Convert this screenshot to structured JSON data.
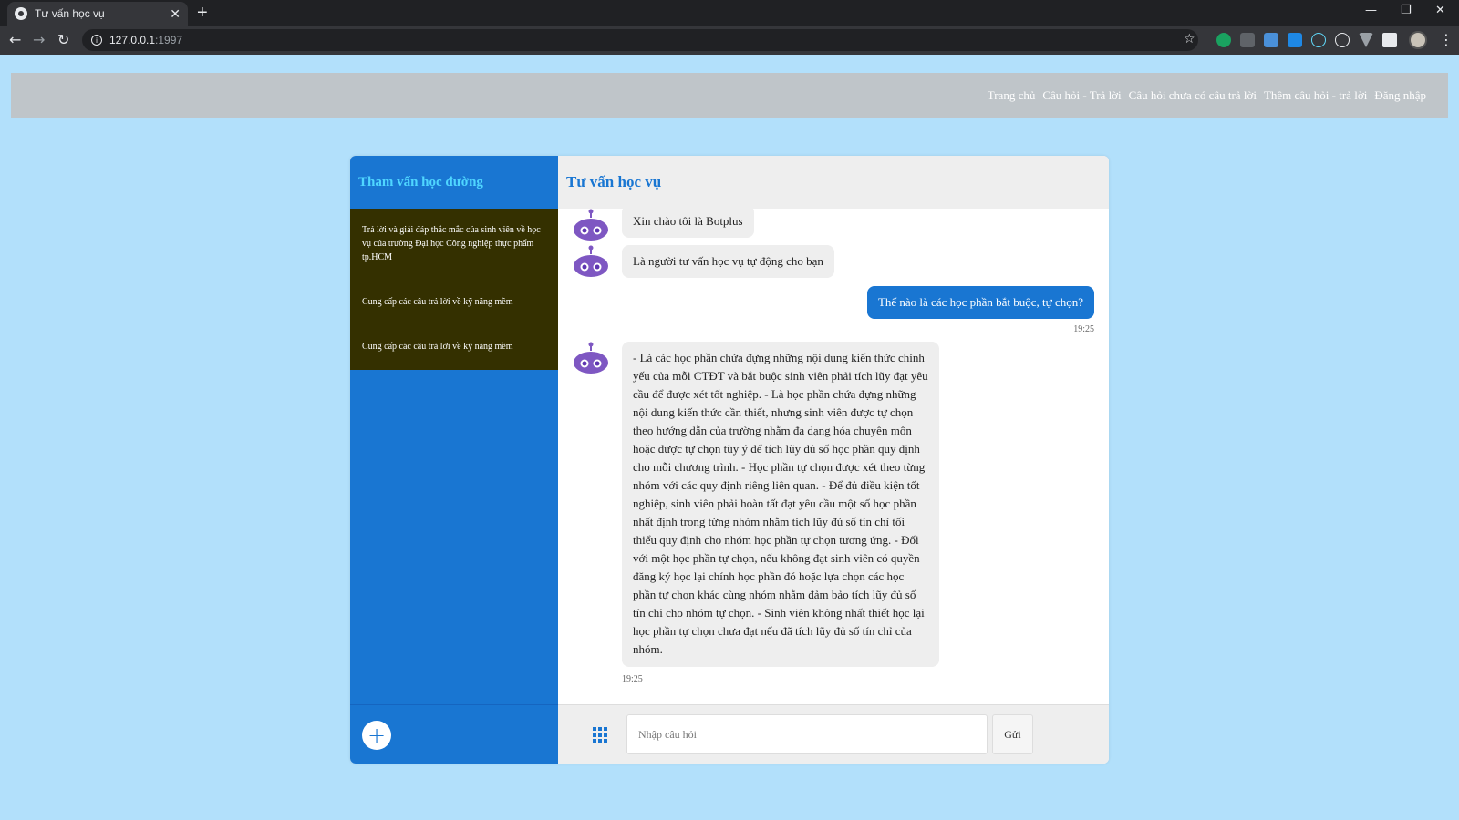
{
  "browser": {
    "tab_title": "Tư vấn học vụ",
    "tab_close": "✕",
    "new_tab": "+",
    "url_host": "127.0.0.1",
    "url_port": ":1997",
    "window_minimize": "—",
    "window_restore": "❐",
    "window_close": "✕",
    "nav_back": "←",
    "nav_forward": "→",
    "nav_reload": "↻",
    "bookmark": "☆",
    "menu": "⋮"
  },
  "topnav": {
    "items": [
      "Trang chủ",
      "Câu hỏi - Trả lời",
      "Câu hỏi chưa có câu trả lời",
      "Thêm câu hỏi - trả lời",
      "Đăng nhập"
    ]
  },
  "sidebar": {
    "title": "Tham vấn học đường",
    "items": [
      "Trả lời và giải đáp thắc mắc của sinh viên về học vụ của trường Đại học Công nghiệp thực phẩm tp.HCM",
      "Cung cấp các câu trả lời về kỹ năng mềm",
      "Cung cấp các câu trả lời về kỹ năng mềm"
    ],
    "add_label": "+"
  },
  "chat": {
    "title": "Tư vấn học vụ",
    "messages": [
      {
        "from": "bot",
        "text": "Xin chào tôi là Botplus"
      },
      {
        "from": "bot",
        "text": "Là người tư vấn học vụ tự động cho bạn"
      },
      {
        "from": "user",
        "text": "Thế nào là các học phần bắt buộc, tự chọn?",
        "time": "19:25"
      },
      {
        "from": "bot",
        "text": "- Là các học phần chứa đựng những nội dung kiến thức chính yếu của mỗi CTĐT và bắt buộc sinh viên phải tích lũy đạt yêu cầu để được xét tốt nghiệp. - Là học phần chứa đựng những nội dung kiến thức cần thiết, nhưng sinh viên được tự chọn theo hướng dẫn của trường nhằm đa dạng hóa chuyên môn hoặc được tự chọn tùy ý để tích lũy đủ số học phần quy định cho mỗi chương trình. - Học phần tự chọn được xét theo từng nhóm với các quy định riêng liên quan. - Để đủ điều kiện tốt nghiệp, sinh viên phải hoàn tất đạt yêu cầu một số học phần nhất định trong từng nhóm nhằm tích lũy đủ số tín chỉ tối thiểu quy định cho nhóm học phần tự chọn tương ứng. - Đối với một học phần tự chọn, nếu không đạt sinh viên có quyền đăng ký học lại chính học phần đó hoặc lựa chọn các học phần tự chọn khác cùng nhóm nhằm đảm bảo tích lũy đủ số tín chỉ cho nhóm tự chọn. - Sinh viên không nhất thiết học lại học phần tự chọn chưa đạt nếu đã tích lũy đủ số tín chỉ của nhóm.",
        "time": "19:25"
      }
    ],
    "input_placeholder": "Nhập câu hỏi",
    "send_label": "Gửi"
  },
  "colors": {
    "page_bg": "#b2e0fb",
    "sidebar_bg": "#1976d2",
    "sidebar_list_bg": "#343000",
    "accent": "#1976d2",
    "bot_avatar": "#7e57c2"
  }
}
